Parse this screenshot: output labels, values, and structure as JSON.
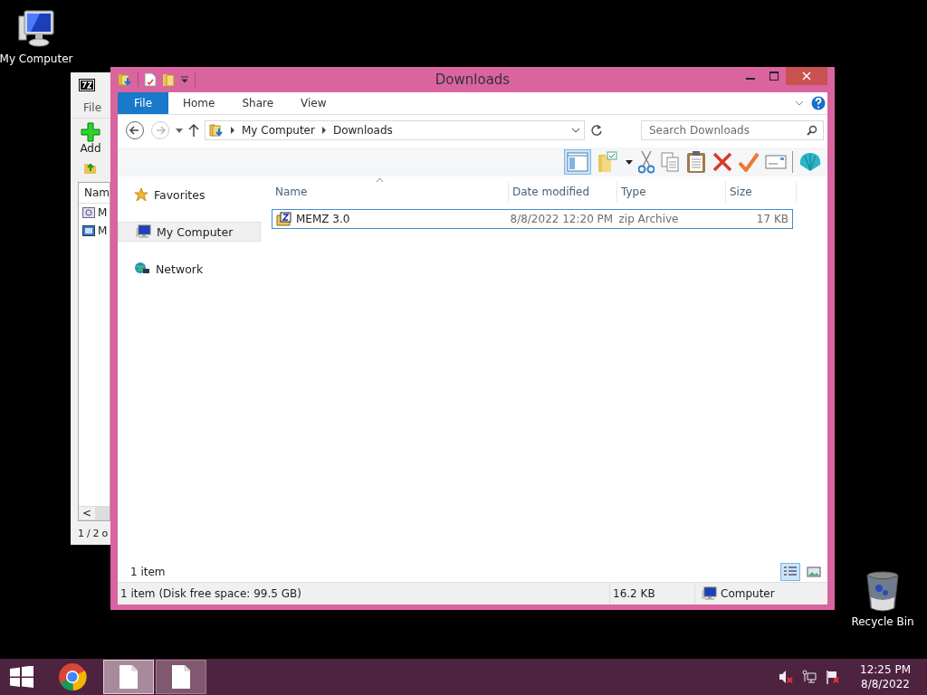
{
  "desktop_icons": [
    {
      "label": "My Computer",
      "kind": "computer"
    },
    {
      "label": "Recycle Bin",
      "kind": "bin"
    }
  ],
  "background_window": {
    "menu": [
      "File"
    ],
    "toolbar": [
      "Add"
    ],
    "column": "Nam",
    "rows": [
      "M",
      "M"
    ],
    "scroll_left": "<",
    "status": "1 / 2 o"
  },
  "explorer": {
    "title": "Downloads",
    "ribbon_tabs": [
      {
        "label": "File",
        "kind": "file",
        "selected": false
      },
      {
        "label": "Home",
        "kind": "tab",
        "selected": false
      },
      {
        "label": "Share",
        "kind": "tab",
        "selected": false
      },
      {
        "label": "View",
        "kind": "tab",
        "selected": false
      }
    ],
    "address": [
      "My Computer",
      "Downloads"
    ],
    "search": {
      "placeholder": "Search Downloads"
    },
    "navigation": [
      {
        "label": "Favorites",
        "kind": "star",
        "selected": false
      },
      {
        "label": "My Computer",
        "kind": "computer",
        "selected": true
      },
      {
        "label": "Network",
        "kind": "network",
        "selected": false
      }
    ],
    "columns": [
      "Name",
      "Date modified",
      "Type",
      "Size"
    ],
    "rows": [
      {
        "name": "MEMZ 3.0",
        "date_modified": "8/8/2022 12:20 PM",
        "type": "zip Archive",
        "size": "17 KB",
        "selected": true
      }
    ],
    "item_count": "1 item",
    "view_buttons": [
      {
        "kind": "details",
        "selected": true
      },
      {
        "kind": "thumbnails",
        "selected": false
      }
    ],
    "status_bar": [
      "1 item (Disk free space: 99.5 GB)",
      "16.2 KB",
      "Computer"
    ]
  },
  "taskbar": {
    "buttons": [
      {
        "kind": "start",
        "active": false
      },
      {
        "kind": "browser",
        "active": false
      },
      {
        "kind": "document",
        "active": true
      },
      {
        "kind": "document",
        "active": false
      }
    ],
    "time": "12:25 PM",
    "date": "8/8/2022"
  }
}
